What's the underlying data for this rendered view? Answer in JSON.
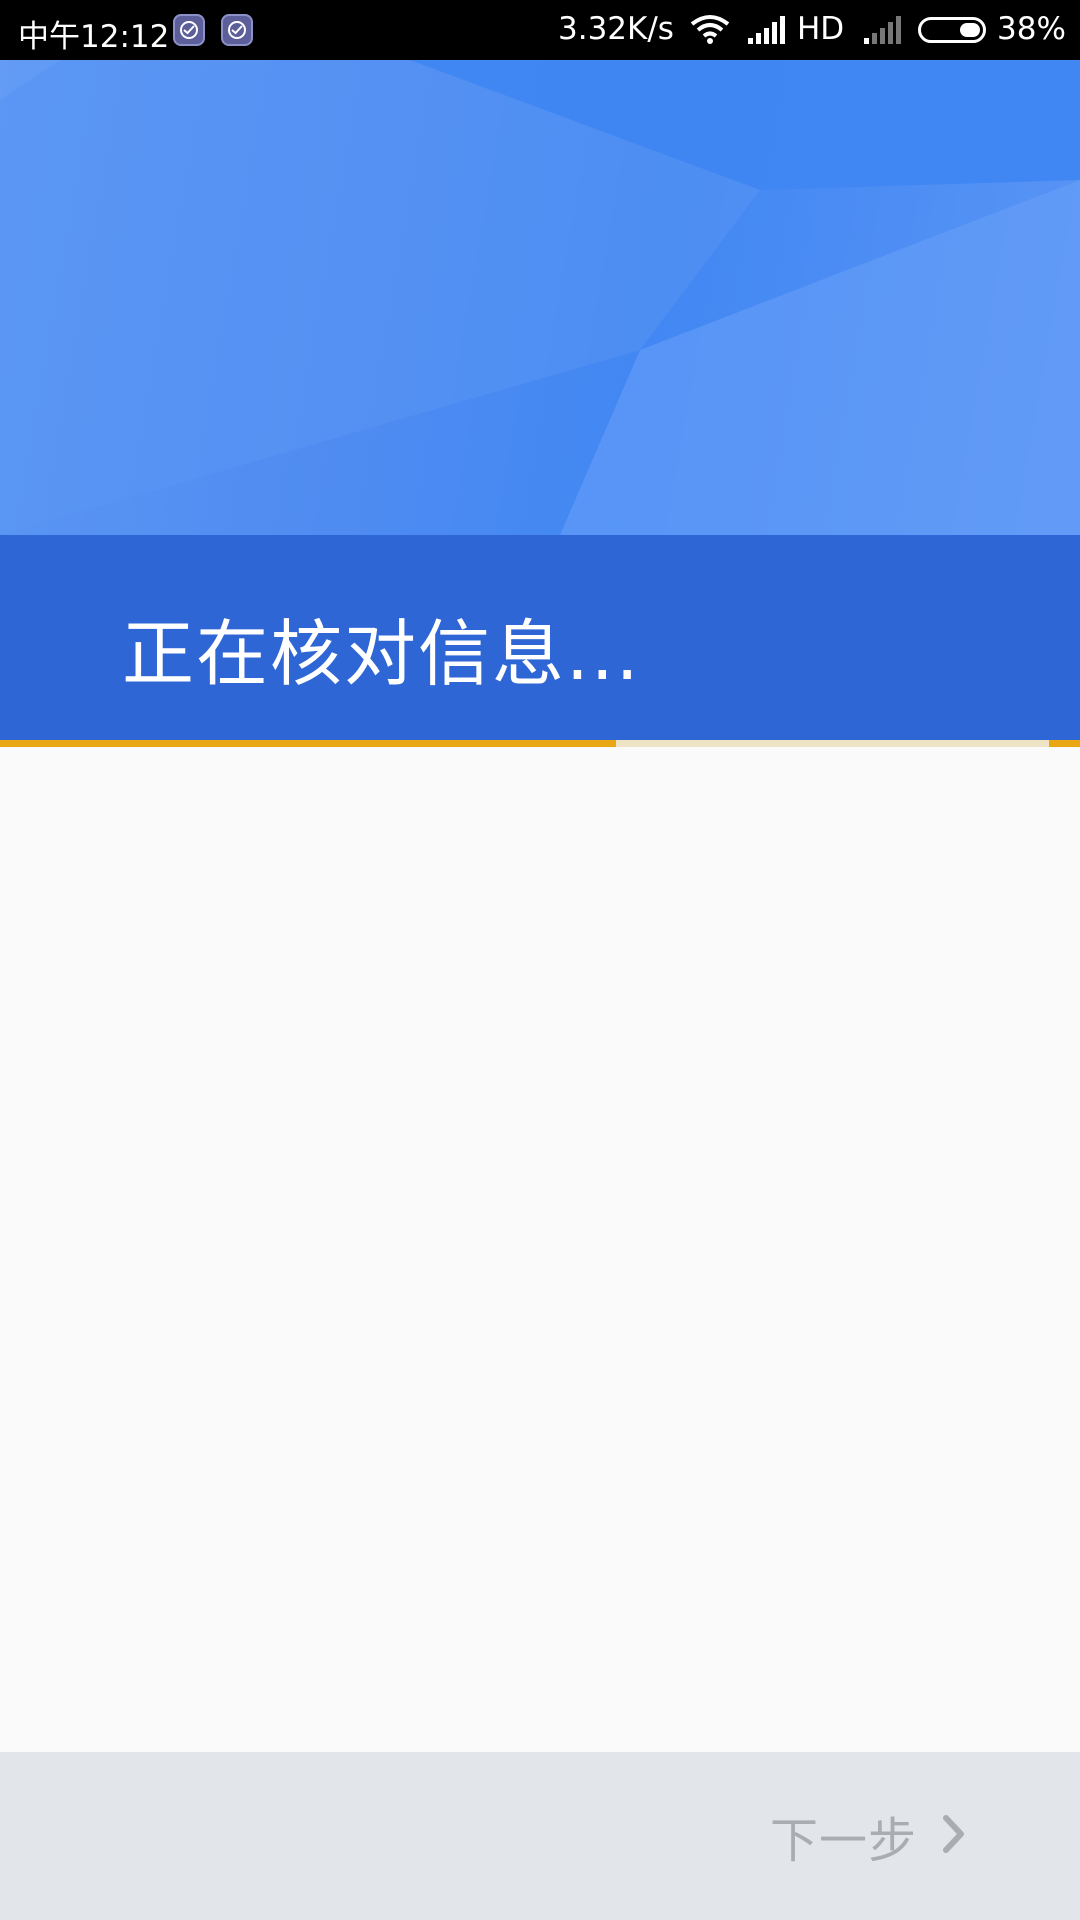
{
  "status_bar": {
    "time": "中午12:12",
    "app_icons": [
      "app-check-icon",
      "app-check-icon"
    ],
    "network_speed": "3.32K/s",
    "wifi_icon": "wifi-icon",
    "signal_icon": "cell-signal-icon",
    "network_type": "HD",
    "battery_percent_text": "38%",
    "battery_level": 0.38
  },
  "header": {
    "title": "正在核对信息...",
    "primary_color": "#2f66d6",
    "art_color": "#4f8cf1"
  },
  "progress": {
    "value": 0.57,
    "color": "#e9a714",
    "remainder_color": "#efe3c5"
  },
  "footer": {
    "next_label": "下一步",
    "next_icon": "chevron-right-icon",
    "disabled_color": "#a9adb2"
  }
}
